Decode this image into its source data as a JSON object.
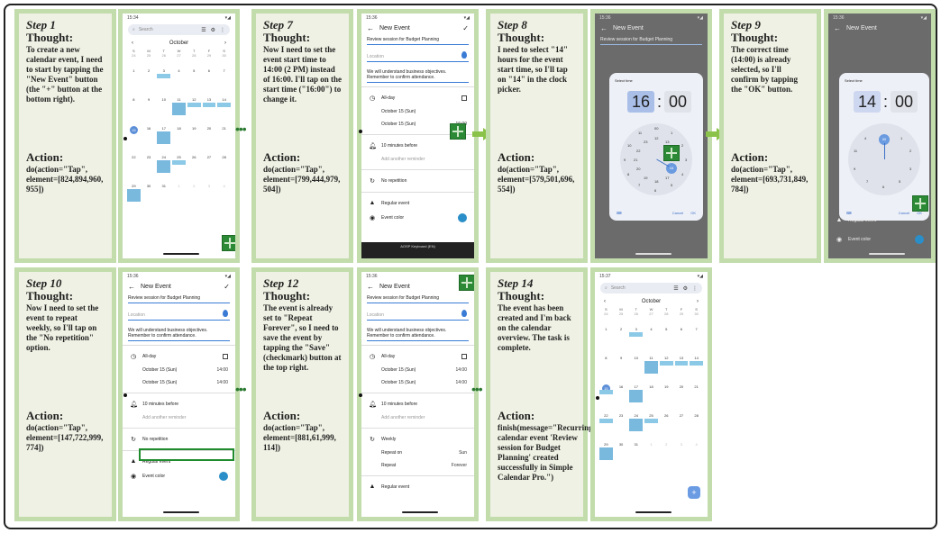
{
  "steps": [
    {
      "title": "Step 1",
      "thought_label": "Thought:",
      "thought": "To create a new calendar event, I need to start by tapping the \"New Event\" button (the \"+\" button at the bottom right).",
      "action_label": "Action:",
      "action": "do(action=\"Tap\", element=[824,894,960, 955])"
    },
    {
      "title": "Step 7",
      "thought_label": "Thought:",
      "thought": "Now I need to set the event start time to 14:00 (2 PM) instead of 16:00. I'll tap on the start time (\"16:00\") to change it.",
      "action_label": "Action:",
      "action": "do(action=\"Tap\", element=[799,444,979, 504])"
    },
    {
      "title": "Step 8",
      "thought_label": "Thought:",
      "thought": "I need to select \"14\" hours for the event start time, so I'll tap on \"14\" in the clock picker.",
      "action_label": "Action:",
      "action": "do(action=\"Tap\", element=[579,501,696, 554])"
    },
    {
      "title": "Step 9",
      "thought_label": "Thought:",
      "thought": "The correct time (14:00) is already selected, so I'll confirm by tapping the \"OK\" button.",
      "action_label": "Action:",
      "action": "do(action=\"Tap\", element=[693,731,849, 784])"
    },
    {
      "title": "Step 10",
      "thought_label": "Thought:",
      "thought": "Now I need to set the event to repeat weekly, so I'll tap on the \"No repetition\" option.",
      "action_label": "Action:",
      "action": "do(action=\"Tap\", element=[147,722,999, 774])"
    },
    {
      "title": "Step 12",
      "thought_label": "Thought:",
      "thought": "The event is already set to \"Repeat Forever\", so I need to save the event by tapping the \"Save\" (checkmark) button at the top right.",
      "action_label": "Action:",
      "action": "do(action=\"Tap\", element=[881,61,999, 114])"
    },
    {
      "title": "Step 14",
      "thought_label": "Thought:",
      "thought": "The event has been created and I'm back on the calendar overview. The task is complete.",
      "action_label": "Action:",
      "action": "finish(message=\"Recurring calendar event 'Review session for Budget Planning' created successfully in Simple Calendar Pro.\")"
    }
  ],
  "status": {
    "t1": "15:34",
    "t2": "15:36",
    "t3": "15:37"
  },
  "calendar": {
    "search": "Search",
    "month": "October",
    "prev": "‹",
    "next": "›",
    "dow": [
      "S",
      "M",
      "T",
      "W",
      "T",
      "F",
      "S"
    ],
    "prev_dates": [
      "24",
      "25",
      "26",
      "27",
      "28",
      "29",
      "30"
    ],
    "weeks": [
      [
        "1",
        "2",
        "3",
        "4",
        "5",
        "6",
        "7"
      ],
      [
        "8",
        "9",
        "10",
        "11",
        "12",
        "13",
        "14"
      ],
      [
        "15",
        "16",
        "17",
        "18",
        "19",
        "20",
        "21"
      ],
      [
        "22",
        "23",
        "24",
        "25",
        "26",
        "27",
        "28"
      ],
      [
        "29",
        "30",
        "31",
        "1",
        "2",
        "3",
        "4"
      ]
    ]
  },
  "event": {
    "app_title": "New Event",
    "title_value": "Review session for Budget Planning",
    "location_ph": "Location",
    "description": "We will understand business objectives. Remember to confirm attendance.",
    "allday": "All-day",
    "start_date": "October 15 (Sun)",
    "end_date": "October 15 (Sun)",
    "time_16": "16:00",
    "time_14": "14:00",
    "reminder": "10 minutes before",
    "add_reminder": "Add another reminder",
    "no_repetition": "No repetition",
    "weekly": "Weekly",
    "repeat_on": "Repeat on",
    "repeat_on_val": "Sun",
    "repeat": "Repeat",
    "repeat_val": "Forever",
    "regular": "Regular event",
    "color": "Event color",
    "keyboard": "AOSP Keyboard (EN)"
  },
  "picker": {
    "label": "Select time",
    "hour16": "16",
    "hour14": "14",
    "colon": ":",
    "min": "00",
    "cancel": "Cancel",
    "ok": "OK",
    "nums_outer": [
      "00",
      "1",
      "2",
      "3",
      "4",
      "5",
      "6",
      "7",
      "8",
      "9",
      "10",
      "11"
    ],
    "nums_inner": [
      "12",
      "13",
      "14",
      "15",
      "16",
      "17",
      "18",
      "19",
      "20",
      "21",
      "22",
      "23"
    ]
  },
  "ellipsis": "•••"
}
